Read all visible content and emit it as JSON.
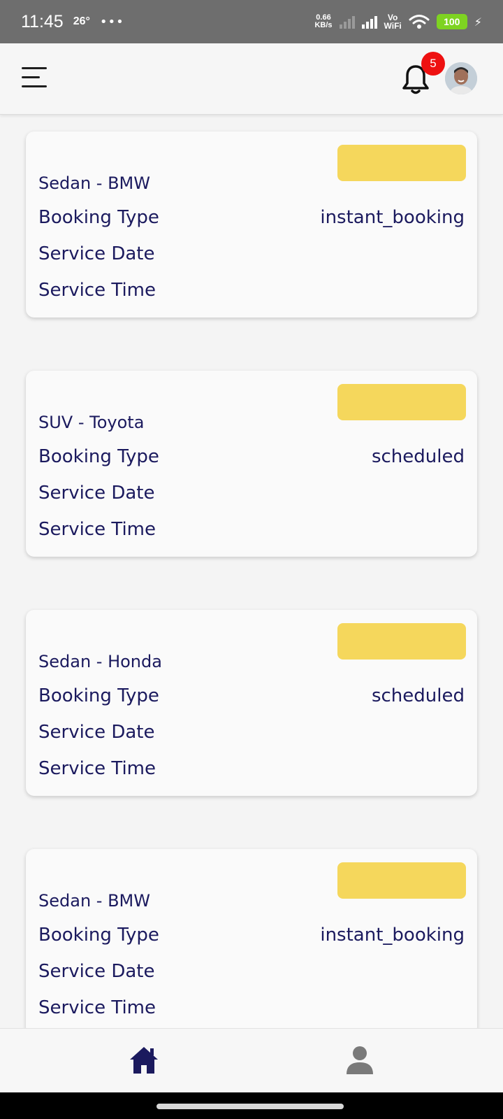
{
  "status_bar": {
    "time": "11:45",
    "temperature": "26°",
    "more_indicator": "•••",
    "net_speed_value": "0.66",
    "net_speed_unit": "KB/s",
    "vowifi_top": "Vo",
    "vowifi_bottom": "WiFi",
    "battery_level": "100",
    "charging_icon": "⚡"
  },
  "header": {
    "menu_icon": "hamburger-menu-icon",
    "bell_icon": "bell-icon",
    "notification_count": "5",
    "avatar_icon": "user-avatar-photo"
  },
  "colors": {
    "text_primary": "#1b1a5e",
    "status_chip": "#f5d75c",
    "badge": "#ee1111",
    "nav_active": "#1b1a5e",
    "nav_inactive": "#7a7a7a"
  },
  "bookings": [
    {
      "vehicle": "Sedan - BMW",
      "booking_type_label": "Booking Type",
      "booking_type_value": "instant_booking",
      "service_date_label": "Service Date",
      "service_date_value": "",
      "service_time_label": "Service Time",
      "service_time_value": ""
    },
    {
      "vehicle": "SUV - Toyota",
      "booking_type_label": "Booking Type",
      "booking_type_value": "scheduled",
      "service_date_label": "Service Date",
      "service_date_value": "",
      "service_time_label": "Service Time",
      "service_time_value": ""
    },
    {
      "vehicle": "Sedan - Honda",
      "booking_type_label": "Booking Type",
      "booking_type_value": "scheduled",
      "service_date_label": "Service Date",
      "service_date_value": "",
      "service_time_label": "Service Time",
      "service_time_value": ""
    },
    {
      "vehicle": "Sedan - BMW",
      "booking_type_label": "Booking Type",
      "booking_type_value": "instant_booking",
      "service_date_label": "Service Date",
      "service_date_value": "",
      "service_time_label": "Service Time",
      "service_time_value": ""
    }
  ],
  "bottom_nav": {
    "home_icon": "home-icon",
    "home_active": true,
    "profile_icon": "person-icon",
    "profile_active": false
  }
}
